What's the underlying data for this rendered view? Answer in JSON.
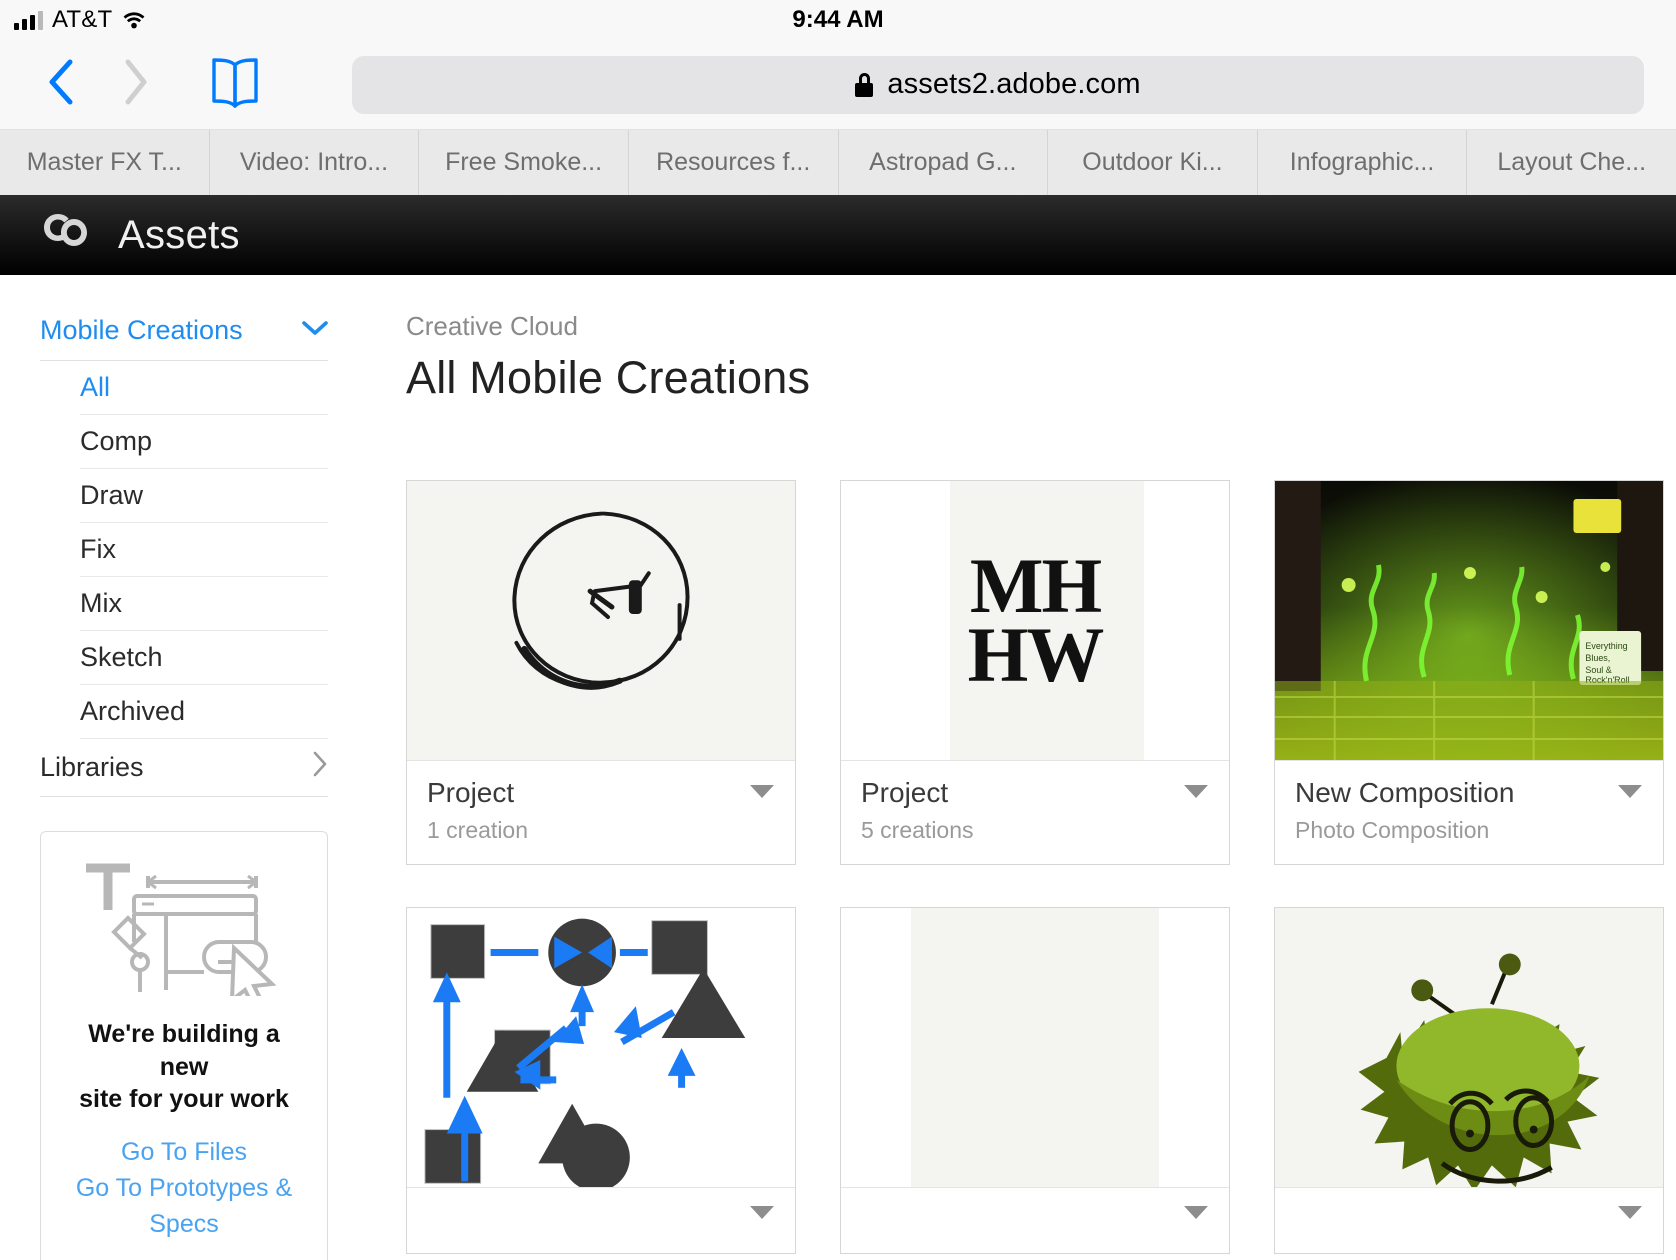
{
  "status_bar": {
    "carrier": "AT&T",
    "time": "9:44 AM",
    "signal_icon": "signal-bars-icon",
    "wifi_icon": "wifi-icon"
  },
  "browser": {
    "back_icon": "chevron-left-icon",
    "forward_icon": "chevron-right-icon",
    "bookmarks_icon": "book-icon",
    "lock_icon": "lock-icon",
    "url": "assets2.adobe.com",
    "tabs": [
      "Master FX T...",
      "Video: Intro...",
      "Free Smoke...",
      "Resources f...",
      "Astropad G...",
      "Outdoor Ki...",
      "Infographic...",
      "Layout Che..."
    ]
  },
  "app_header": {
    "logo_icon": "creative-cloud-logo-icon",
    "title": "Assets"
  },
  "sidebar": {
    "group": {
      "title": "Mobile Creations",
      "caret_icon": "chevron-down-icon"
    },
    "items": [
      {
        "label": "All",
        "active": true
      },
      {
        "label": "Comp",
        "active": false
      },
      {
        "label": "Draw",
        "active": false
      },
      {
        "label": "Fix",
        "active": false
      },
      {
        "label": "Mix",
        "active": false
      },
      {
        "label": "Sketch",
        "active": false
      },
      {
        "label": "Archived",
        "active": false
      }
    ],
    "libraries": {
      "label": "Libraries",
      "chevron_icon": "chevron-right-icon"
    },
    "promo": {
      "art_icon": "design-tools-illustration-icon",
      "title_line1": "We're building a new",
      "title_line2": "site for your work",
      "links": [
        "Go To Files",
        "Go To Prototypes & Specs"
      ]
    }
  },
  "main": {
    "breadcrumb": "Creative Cloud",
    "title": "All Mobile Creations",
    "cards": [
      {
        "name": "Project",
        "subtitle": "1 creation",
        "menu_icon": "triangle-down-icon",
        "thumb": "sketch-circle-drawing"
      },
      {
        "name": "Project",
        "subtitle": "5 creations",
        "menu_icon": "triangle-down-icon",
        "thumb": "monogram-mh-hw",
        "monogram_line1": "MH",
        "monogram_line2": "HW"
      },
      {
        "name": "New Composition",
        "subtitle": "Photo Composition",
        "menu_icon": "triangle-down-icon",
        "thumb": "green-smoke-street-photo"
      },
      {
        "name": "",
        "subtitle": "",
        "menu_icon": "triangle-down-icon",
        "thumb": "shapes-and-arrows-diagram"
      },
      {
        "name": "",
        "subtitle": "",
        "menu_icon": "triangle-down-icon",
        "thumb": "blank-canvas"
      },
      {
        "name": "",
        "subtitle": "",
        "menu_icon": "triangle-down-icon",
        "thumb": "green-monster-character"
      }
    ]
  },
  "colors": {
    "accent_blue": "#1e8cf0",
    "link_blue": "#4aa3f0",
    "header_black": "#000000",
    "thumb_bg": "#f4f4f0"
  }
}
